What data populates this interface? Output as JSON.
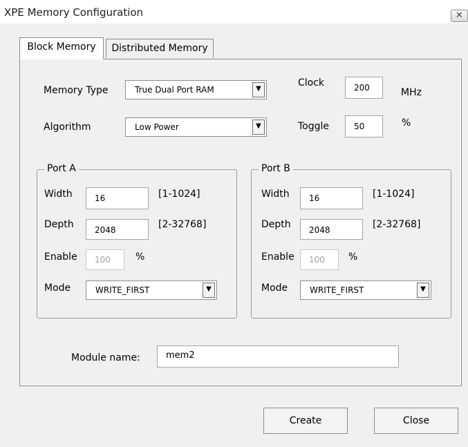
{
  "window": {
    "title": "XPE Memory Configuration",
    "close_glyph": "✕"
  },
  "tabs": [
    {
      "label": "Block Memory",
      "active": true
    },
    {
      "label": "Distributed Memory",
      "active": false
    }
  ],
  "top": {
    "memory_type_label": "Memory Type",
    "memory_type_value": "True Dual Port RAM",
    "algorithm_label": "Algorithm",
    "algorithm_value": "Low Power",
    "clock_label": "Clock",
    "clock_value": "200",
    "clock_unit": "MHz",
    "toggle_label": "Toggle",
    "toggle_value": "50",
    "toggle_unit": "%"
  },
  "port_a": {
    "legend": "Port A",
    "width_label": "Width",
    "width_value": "16",
    "width_range": "[1-1024]",
    "depth_label": "Depth",
    "depth_value": "2048",
    "depth_range": "[2-32768]",
    "enable_label": "Enable",
    "enable_value": "100",
    "enable_unit": "%",
    "mode_label": "Mode",
    "mode_value": "WRITE_FIRST"
  },
  "port_b": {
    "legend": "Port B",
    "width_label": "Width",
    "width_value": "16",
    "width_range": "[1-1024]",
    "depth_label": "Depth",
    "depth_value": "2048",
    "depth_range": "[2-32768]",
    "enable_label": "Enable",
    "enable_value": "100",
    "enable_unit": "%",
    "mode_label": "Mode",
    "mode_value": "WRITE_FIRST"
  },
  "module": {
    "label": "Module name:",
    "value": "mem2"
  },
  "buttons": {
    "create": "Create",
    "close": "Close"
  },
  "icons": {
    "dropdown": "▼"
  }
}
